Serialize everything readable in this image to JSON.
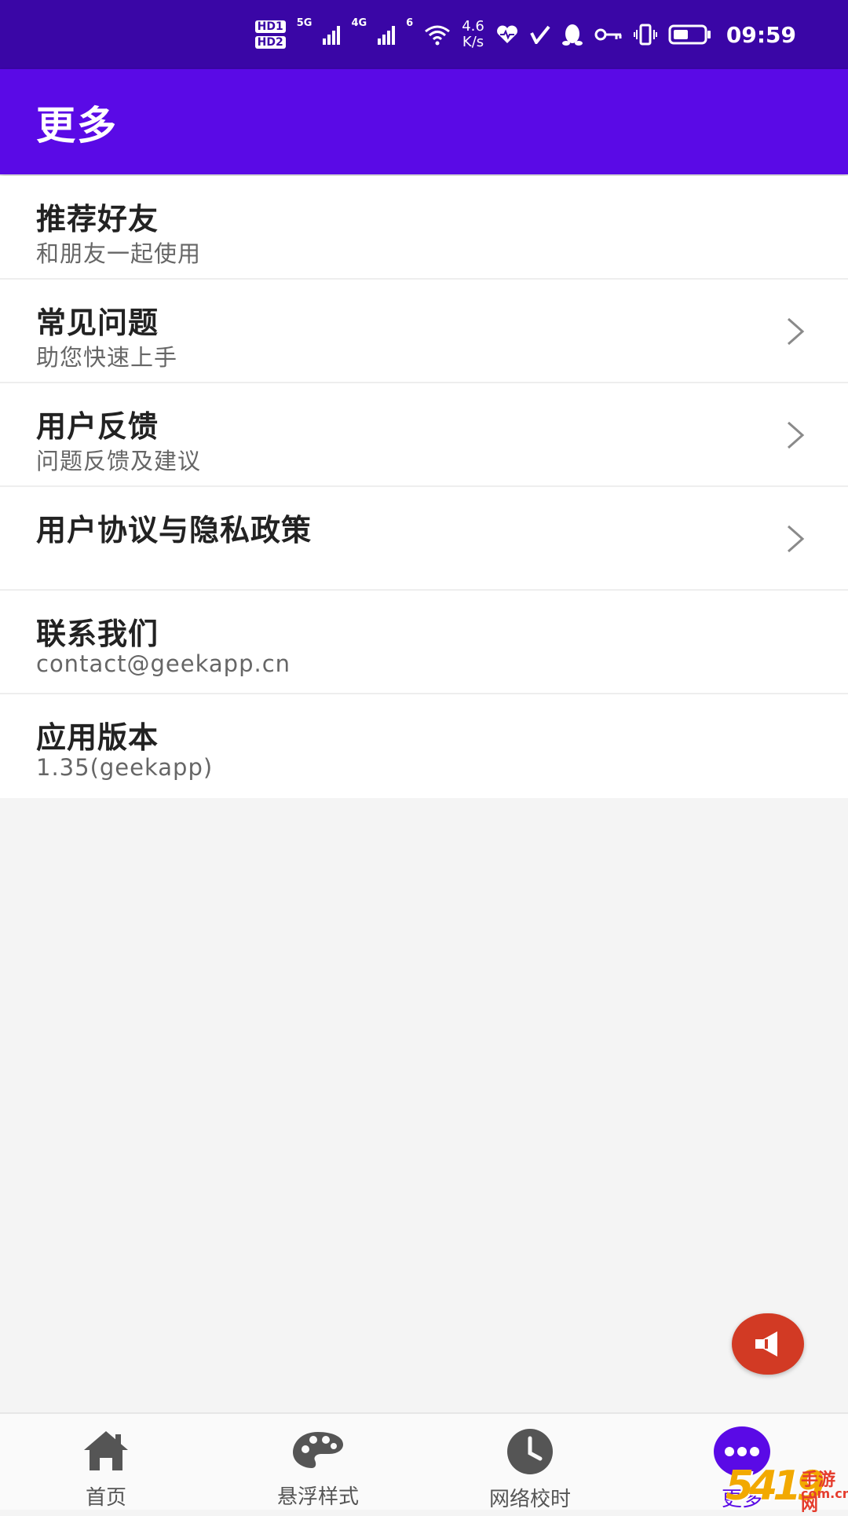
{
  "status_bar": {
    "hd1": "HD",
    "hd1_sub": "1",
    "hd2": "HD",
    "hd2_sub": "2",
    "net1": "5G",
    "net2": "4G",
    "wifi_gen": "6",
    "speed_value": "4.6",
    "speed_unit": "K/s",
    "time": "09:59"
  },
  "app_bar": {
    "title": "更多"
  },
  "list": {
    "items": [
      {
        "title": "推荐好友",
        "subtitle": "和朋友一起使用",
        "has_chevron": false
      },
      {
        "title": "常见问题",
        "subtitle": "助您快速上手",
        "has_chevron": true
      },
      {
        "title": "用户反馈",
        "subtitle": "问题反馈及建议",
        "has_chevron": true
      },
      {
        "title": "用户协议与隐私政策",
        "subtitle": "",
        "has_chevron": true
      },
      {
        "title": "联系我们",
        "subtitle": "contact@geekapp.cn",
        "has_chevron": false
      },
      {
        "title": "应用版本",
        "subtitle": "1.35(geekapp)",
        "has_chevron": false
      }
    ]
  },
  "fab": {
    "icon": "megaphone-icon",
    "color": "#d23a24"
  },
  "bottom_nav": {
    "items": [
      {
        "label": "首页",
        "icon": "home-icon",
        "active": false
      },
      {
        "label": "悬浮样式",
        "icon": "palette-icon",
        "active": false
      },
      {
        "label": "网络校时",
        "icon": "clock-icon",
        "active": false
      },
      {
        "label": "更多",
        "icon": "more-icon",
        "active": true
      }
    ]
  },
  "watermark": {
    "number": "5419",
    "text": "手游网",
    "url": "com.cn"
  },
  "colors": {
    "status_bar": "#3a06a6",
    "app_bar": "#5a0ae6",
    "accent": "#5a0ae6",
    "fab": "#d23a24"
  }
}
